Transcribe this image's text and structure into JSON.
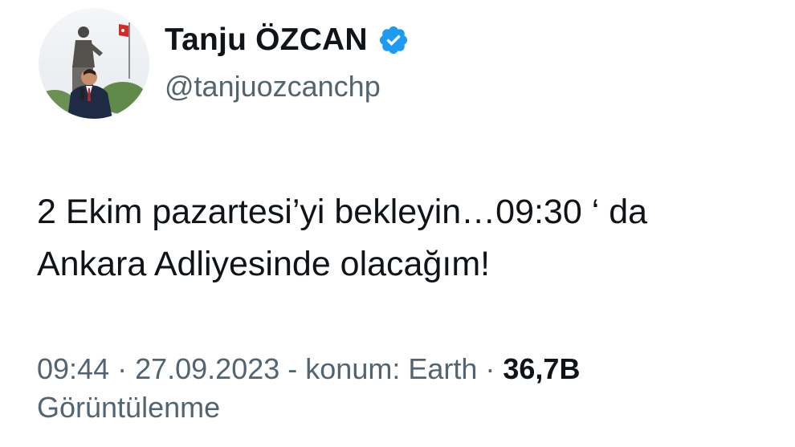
{
  "author": {
    "display_name": "Tanju ÖZCAN",
    "handle": "@tanjuozcanchp",
    "avatar_icon": "profile-photo",
    "verified_icon": "verified-badge-icon",
    "verified_color": "#1d9bf0"
  },
  "tweet": {
    "text_lines": [
      "2 Ekim pazartesi’yi bekleyin…09:30 ‘ da",
      "Ankara Adliyesinde olacağım!"
    ]
  },
  "meta": {
    "time": "09:44",
    "dot1": " · ",
    "date": "27.09.2023",
    "location_prefix": " - konum: ",
    "location": "Earth",
    "dot2": " · ",
    "views_count": "36,7B",
    "views_label": "Görüntülenme"
  },
  "colors": {
    "text_primary": "#0f1419",
    "text_secondary": "#536471",
    "background": "#ffffff"
  }
}
